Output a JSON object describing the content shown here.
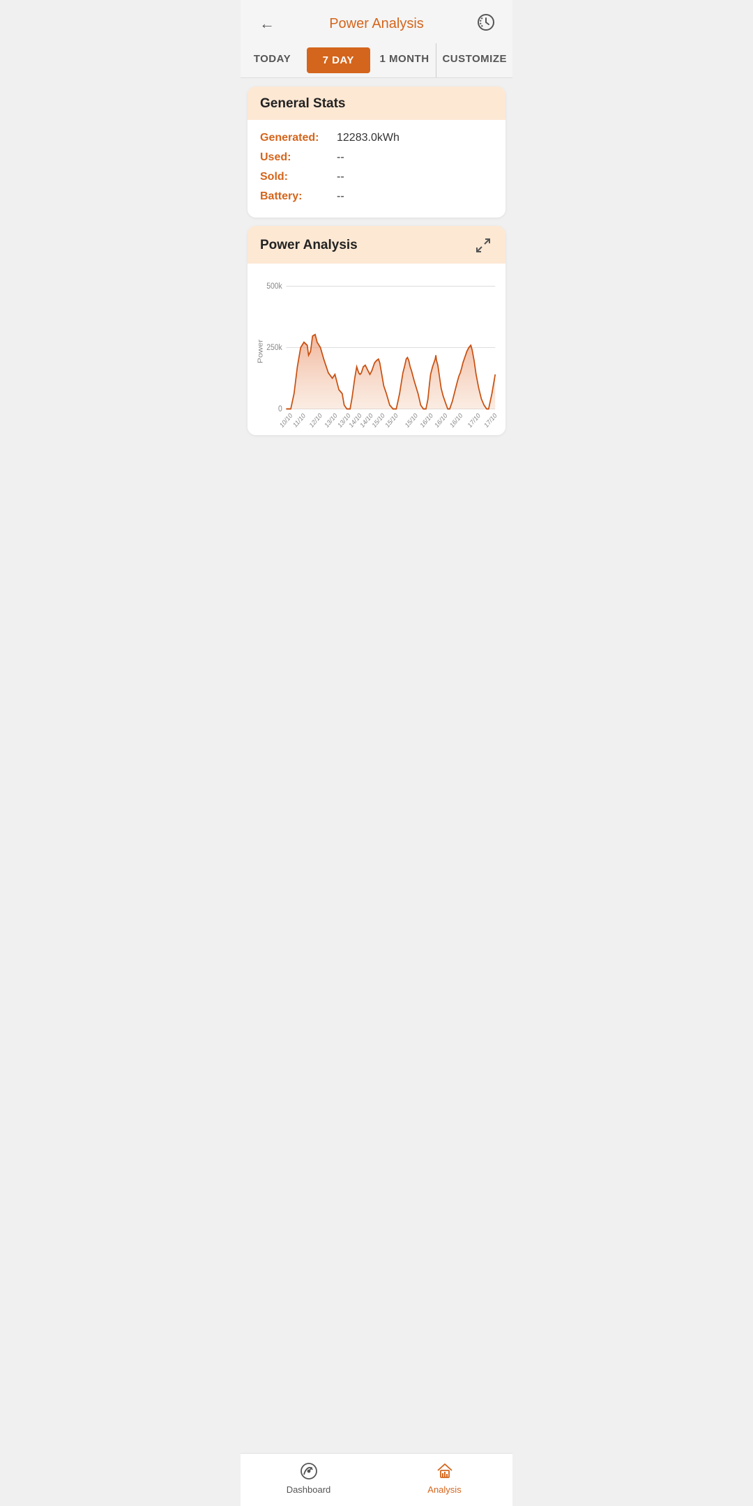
{
  "header": {
    "title": "Power Analysis",
    "back_label": "back",
    "logout_label": "logout"
  },
  "tabs": [
    {
      "id": "today",
      "label": "TODAY",
      "active": false
    },
    {
      "id": "7day",
      "label": "7 DAY",
      "active": true
    },
    {
      "id": "1month",
      "label": "1 MONTH",
      "active": false
    },
    {
      "id": "customize",
      "label": "CUSTOMIZE",
      "active": false
    }
  ],
  "general_stats": {
    "title": "General Stats",
    "rows": [
      {
        "label": "Generated:",
        "value": "12283.0kWh"
      },
      {
        "label": "Used:",
        "value": "--"
      },
      {
        "label": "Sold:",
        "value": "--"
      },
      {
        "label": "Battery:",
        "value": "--"
      }
    ]
  },
  "power_analysis": {
    "title": "Power Analysis",
    "y_axis_label": "Power",
    "y_max": "500k",
    "y_mid": "250k",
    "y_min": "0",
    "x_labels": [
      "10/10",
      "11/10",
      "12/10",
      "13/10",
      "13/10",
      "14/10",
      "14/10",
      "15/10",
      "15/10",
      "15/10",
      "16/10",
      "16/10",
      "16/10",
      "17/10",
      "17/10"
    ]
  },
  "bottom_nav": [
    {
      "id": "dashboard",
      "label": "Dashboard",
      "active": false
    },
    {
      "id": "analysis",
      "label": "Analysis",
      "active": true
    }
  ],
  "colors": {
    "accent": "#d4651c",
    "accent_light": "#fde8d4",
    "chart_stroke": "#d4651c",
    "chart_fill": "#f0a070"
  }
}
